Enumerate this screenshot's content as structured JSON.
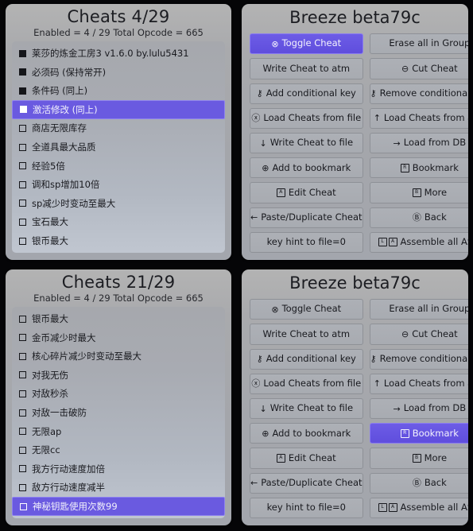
{
  "panels": {
    "top_left": {
      "title": "Cheats 4/29",
      "subtitle": "Enabled = 4 / 29  Total Opcode = 665",
      "items": [
        {
          "label": "莱莎的炼金工房3 v1.6.0 by.lulu5431",
          "checked": true,
          "selected": false
        },
        {
          "label": "必须码 (保持常开)",
          "checked": true,
          "selected": false
        },
        {
          "label": "条件码 (同上)",
          "checked": true,
          "selected": false
        },
        {
          "label": "激活修改 (同上)",
          "checked": true,
          "selected": true
        },
        {
          "label": "商店无限库存",
          "checked": false,
          "selected": false
        },
        {
          "label": "全道具最大品质",
          "checked": false,
          "selected": false
        },
        {
          "label": "经验5倍",
          "checked": false,
          "selected": false
        },
        {
          "label": "调和sp增加10倍",
          "checked": false,
          "selected": false
        },
        {
          "label": "sp减少时变动至最大",
          "checked": false,
          "selected": false
        },
        {
          "label": "宝石最大",
          "checked": false,
          "selected": false
        },
        {
          "label": "银币最大",
          "checked": false,
          "selected": false
        }
      ]
    },
    "bottom_left": {
      "title": "Cheats 21/29",
      "subtitle": "Enabled = 4 / 29  Total Opcode = 665",
      "items": [
        {
          "label": "银币最大",
          "checked": false,
          "selected": false
        },
        {
          "label": "金币减少时最大",
          "checked": false,
          "selected": false
        },
        {
          "label": "核心碎片减少时变动至最大",
          "checked": false,
          "selected": false
        },
        {
          "label": "对我无伤",
          "checked": false,
          "selected": false
        },
        {
          "label": "对敌秒杀",
          "checked": false,
          "selected": false
        },
        {
          "label": "对敌一击破防",
          "checked": false,
          "selected": false
        },
        {
          "label": "无限ap",
          "checked": false,
          "selected": false
        },
        {
          "label": "无限cc",
          "checked": false,
          "selected": false
        },
        {
          "label": "我方行动速度加倍",
          "checked": false,
          "selected": false
        },
        {
          "label": "敌方行动速度减半",
          "checked": false,
          "selected": false
        },
        {
          "label": "神秘钥匙使用次数99",
          "checked": false,
          "selected": true
        }
      ]
    },
    "top_right": {
      "title": "Breeze beta79c",
      "buttons": [
        {
          "label": "Toggle Cheat",
          "icon": "circle-x-icon",
          "glyph": "⊗",
          "selected": true
        },
        {
          "label": "Erase all in Group",
          "icon": "none",
          "glyph": "",
          "selected": false
        },
        {
          "label": "Write Cheat to atm",
          "icon": "none",
          "glyph": "",
          "selected": false
        },
        {
          "label": "Cut Cheat",
          "icon": "circle-minus-icon",
          "glyph": "⊖",
          "selected": false
        },
        {
          "label": "Add conditional key",
          "icon": "key-icon",
          "glyph": "⚷",
          "selected": false
        },
        {
          "label": "Remove conditional key",
          "icon": "key-icon",
          "glyph": "⚷",
          "selected": false
        },
        {
          "label": "Load Cheats from file",
          "icon": "circle-clock-icon",
          "glyph": "ⓧ",
          "selected": false
        },
        {
          "label": "Load Cheats from atm",
          "icon": "arrow-up-icon",
          "glyph": "↑",
          "selected": false
        },
        {
          "label": "Write Cheat to file",
          "icon": "arrow-down-icon",
          "glyph": "↓",
          "selected": false
        },
        {
          "label": "Load from DB",
          "icon": "arrow-right-icon",
          "glyph": "→",
          "selected": false
        },
        {
          "label": "Add to bookmark",
          "icon": "circle-plus-icon",
          "glyph": "⊕",
          "selected": false
        },
        {
          "label": "Bookmark",
          "icon": "boxed-r-icon",
          "glyph": "R",
          "selected": false
        },
        {
          "label": "Edit Cheat",
          "icon": "boxed-a-icon",
          "glyph": "A",
          "selected": false
        },
        {
          "label": "More",
          "icon": "boxed-b-icon",
          "glyph": "B",
          "selected": false
        },
        {
          "label": "Paste/Duplicate Cheat",
          "icon": "arrow-left-icon",
          "glyph": "←",
          "selected": false
        },
        {
          "label": "Back",
          "icon": "circle-b-icon",
          "glyph": "Ⓑ",
          "selected": false
        },
        {
          "label": "key hint to file=0",
          "icon": "none",
          "glyph": "",
          "selected": false
        },
        {
          "label": "Assemble all ASM",
          "icon": "boxed-l-boxed-a-icon",
          "glyph": "L",
          "glyph2": "A",
          "selected": false
        }
      ]
    },
    "bottom_right": {
      "title": "Breeze beta79c",
      "buttons": [
        {
          "label": "Toggle Cheat",
          "icon": "circle-x-icon",
          "glyph": "⊗",
          "selected": false
        },
        {
          "label": "Erase all in Group",
          "icon": "none",
          "glyph": "",
          "selected": false
        },
        {
          "label": "Write Cheat to atm",
          "icon": "none",
          "glyph": "",
          "selected": false
        },
        {
          "label": "Cut Cheat",
          "icon": "circle-minus-icon",
          "glyph": "⊖",
          "selected": false
        },
        {
          "label": "Add conditional key",
          "icon": "key-icon",
          "glyph": "⚷",
          "selected": false
        },
        {
          "label": "Remove conditional key",
          "icon": "key-icon",
          "glyph": "⚷",
          "selected": false
        },
        {
          "label": "Load Cheats from file",
          "icon": "circle-clock-icon",
          "glyph": "ⓧ",
          "selected": false
        },
        {
          "label": "Load Cheats from atm",
          "icon": "arrow-up-icon",
          "glyph": "↑",
          "selected": false
        },
        {
          "label": "Write Cheat to file",
          "icon": "arrow-down-icon",
          "glyph": "↓",
          "selected": false
        },
        {
          "label": "Load from DB",
          "icon": "arrow-right-icon",
          "glyph": "→",
          "selected": false
        },
        {
          "label": "Add to bookmark",
          "icon": "circle-plus-icon",
          "glyph": "⊕",
          "selected": false
        },
        {
          "label": "Bookmark",
          "icon": "boxed-r-icon",
          "glyph": "R",
          "selected": true
        },
        {
          "label": "Edit Cheat",
          "icon": "boxed-a-icon",
          "glyph": "A",
          "selected": false
        },
        {
          "label": "More",
          "icon": "boxed-b-icon",
          "glyph": "B",
          "selected": false
        },
        {
          "label": "Paste/Duplicate Cheat",
          "icon": "arrow-left-icon",
          "glyph": "←",
          "selected": false
        },
        {
          "label": "Back",
          "icon": "circle-b-icon",
          "glyph": "Ⓑ",
          "selected": false
        },
        {
          "label": "key hint to file=0",
          "icon": "none",
          "glyph": "",
          "selected": false
        },
        {
          "label": "Assemble all ASM",
          "icon": "boxed-l-boxed-a-icon",
          "glyph": "L",
          "glyph2": "A",
          "selected": false
        }
      ]
    }
  },
  "colors": {
    "selection": "#6a5ae0",
    "panel_bg": "#a8aab0",
    "list_bg": "#b0b5be",
    "text": "#18191e"
  }
}
